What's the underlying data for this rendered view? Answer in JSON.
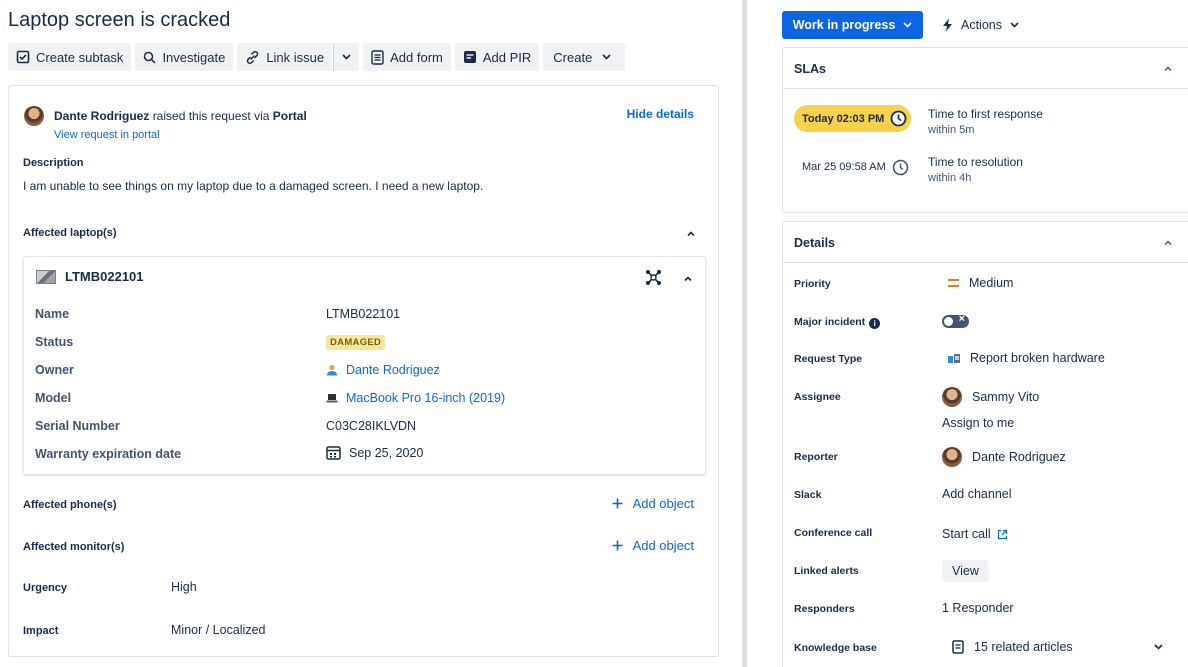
{
  "issue": {
    "title": "Laptop screen is cracked"
  },
  "toolbar": {
    "create_subtask": "Create subtask",
    "investigate": "Investigate",
    "link_issue": "Link issue",
    "add_form": "Add form",
    "add_pir": "Add PIR",
    "create": "Create"
  },
  "request": {
    "reporter_name": "Dante Rodriguez",
    "raised_text": "raised this request via",
    "channel": "Portal",
    "view_portal": "View request in portal",
    "hide_details": "Hide details"
  },
  "description": {
    "label": "Description",
    "text": "I am unable to see things on my laptop due to a damaged screen. I need a new laptop."
  },
  "affected_laptops": {
    "label": "Affected laptop(s)",
    "asset": {
      "id": "LTMB022101",
      "attributes": [
        {
          "label": "Name",
          "value": "LTMB022101"
        },
        {
          "label": "Status",
          "value": "DAMAGED"
        },
        {
          "label": "Owner",
          "value": "Dante Rodriguez"
        },
        {
          "label": "Model",
          "value": "MacBook Pro 16-inch (2019)"
        },
        {
          "label": "Serial Number",
          "value": "C03C28IKLVDN"
        },
        {
          "label": "Warranty expiration date",
          "value": "Sep 25, 2020"
        }
      ]
    }
  },
  "affected_phones": {
    "label": "Affected phone(s)",
    "add": "Add object"
  },
  "affected_monitors": {
    "label": "Affected monitor(s)",
    "add": "Add object"
  },
  "fields": {
    "urgency_label": "Urgency",
    "urgency_value": "High",
    "impact_label": "Impact",
    "impact_value": "Minor / Localized"
  },
  "status_button": "Work in progress",
  "actions_button": "Actions",
  "slas": {
    "title": "SLAs",
    "items": [
      {
        "time": "Today 02:03 PM",
        "name": "Time to first response",
        "sub": "within 5m"
      },
      {
        "time": "Mar 25 09:58 AM",
        "name": "Time to resolution",
        "sub": "within 4h"
      }
    ]
  },
  "details": {
    "title": "Details",
    "priority_label": "Priority",
    "priority_value": "Medium",
    "major_incident_label": "Major incident",
    "request_type_label": "Request Type",
    "request_type_value": "Report broken hardware",
    "assignee_label": "Assignee",
    "assignee_value": "Sammy Vito",
    "assign_to_me": "Assign to me",
    "reporter_label": "Reporter",
    "reporter_value": "Dante Rodriguez",
    "slack_label": "Slack",
    "slack_value": "Add channel",
    "conference_label": "Conference call",
    "conference_value": "Start call",
    "linked_alerts_label": "Linked alerts",
    "linked_alerts_value": "View",
    "responders_label": "Responders",
    "responders_value": "1 Responder",
    "kb_label": "Knowledge base",
    "kb_value": "15 related articles"
  },
  "colors": {
    "accent": "#0c66e4",
    "sla_today": "#f8d24a",
    "damaged_badge": "#f8e6a0"
  }
}
